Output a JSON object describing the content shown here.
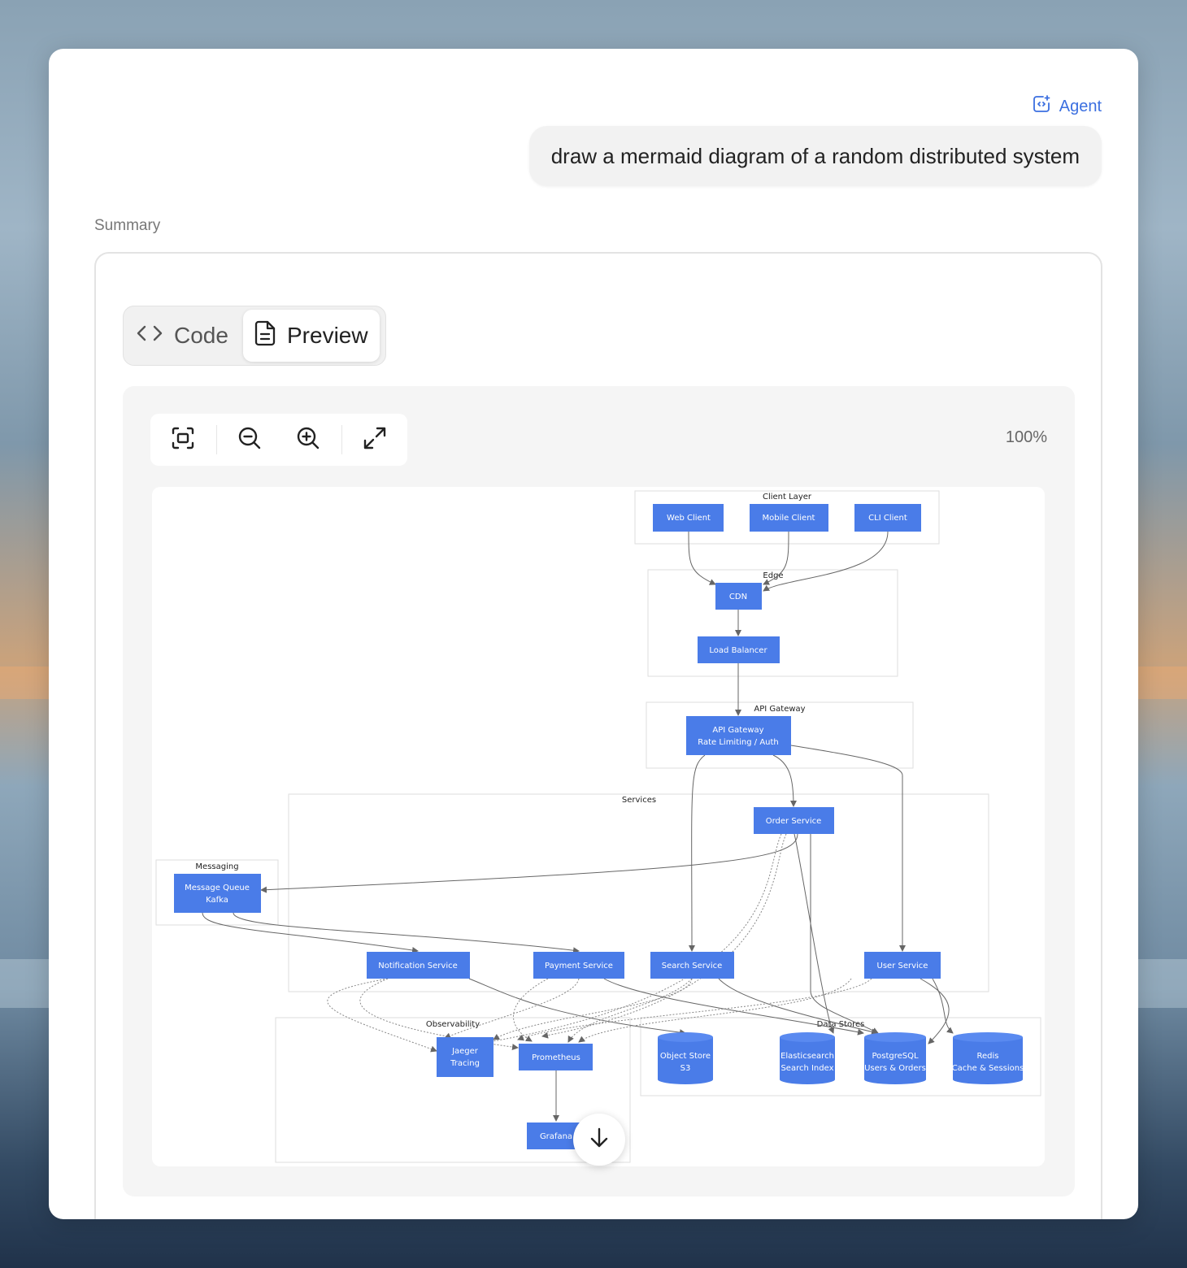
{
  "agent_label": "Agent",
  "prompt": "draw a mermaid diagram of a random distributed system",
  "summary_label": "Summary",
  "tabs": {
    "code": "Code",
    "preview": "Preview"
  },
  "toolbar": {
    "zoom_level": "100%"
  },
  "icons": {
    "agent": "agent-icon",
    "code": "code-icon",
    "preview": "document-icon",
    "fit": "fit-screen-icon",
    "zoom_out": "zoom-out-icon",
    "zoom_in": "zoom-in-icon",
    "fullscreen": "expand-icon",
    "scroll": "arrow-down-icon"
  },
  "colors": {
    "accent": "#3b6fe0",
    "node_fill": "#4a7ce8",
    "node_text": "#ffffff"
  },
  "diagram": {
    "groups": {
      "client_layer": "Client Layer",
      "edge": "Edge",
      "api_gateway": "API Gateway",
      "services": "Services",
      "messaging": "Messaging",
      "observability": "Observability",
      "data_stores": "Data Stores"
    },
    "nodes": {
      "web_client": "Web Client",
      "mobile_client": "Mobile Client",
      "cli_client": "CLI Client",
      "cdn": "CDN",
      "load_balancer": "Load Balancer",
      "api_gateway_l1": "API Gateway",
      "api_gateway_l2": "Rate Limiting / Auth",
      "order_service": "Order Service",
      "mq_l1": "Message Queue",
      "mq_l2": "Kafka",
      "notification_service": "Notification Service",
      "payment_service": "Payment Service",
      "search_service": "Search Service",
      "user_service": "User Service",
      "jaeger_l1": "Jaeger",
      "jaeger_l2": "Tracing",
      "prometheus": "Prometheus",
      "grafana": "Grafana",
      "object_store_l1": "Object Store",
      "object_store_l2": "S3",
      "elasticsearch_l1": "Elasticsearch",
      "elasticsearch_l2": "Search Index",
      "postgres_l1": "PostgreSQL",
      "postgres_l2": "Users & Orders",
      "redis_l1": "Redis",
      "redis_l2": "Cache & Sessions"
    }
  }
}
